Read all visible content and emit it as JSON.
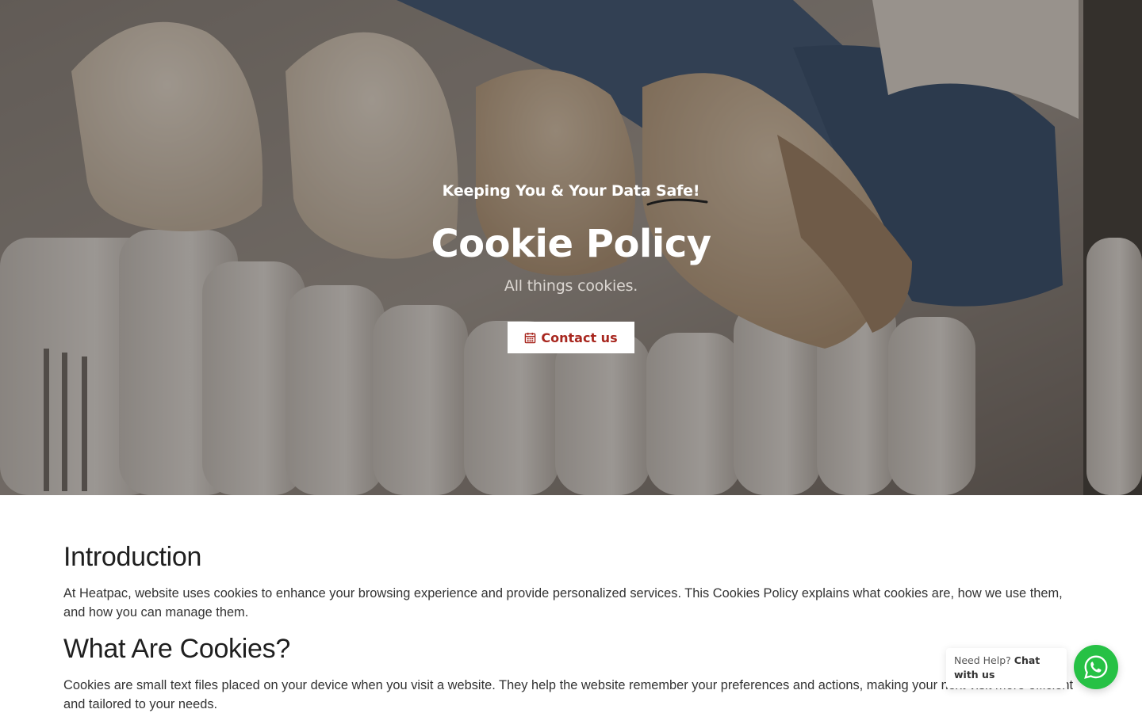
{
  "hero": {
    "tagline_prefix": "Keeping You & Your Data ",
    "tagline_accent": "Safe!",
    "title": "Cookie Policy",
    "subtitle": "All things cookies.",
    "cta_label": "Contact us",
    "cta_icon": "calendar-icon",
    "background_image": "knitted-socks-on-radiator-photo",
    "accent_color": "#a8271f"
  },
  "content": {
    "sections": [
      {
        "heading": "Introduction",
        "body": "At Heatpac, website uses cookies to enhance your browsing experience and provide personalized services. This Cookies Policy explains what cookies are, how we use them, and how you can manage them."
      },
      {
        "heading": "What Are Cookies?",
        "body": "Cookies are small text files placed on your device when you visit a website. They help the website remember your preferences and actions, making your next visit more efficient and tailored to your needs."
      }
    ]
  },
  "chat_widget": {
    "help_prefix": "Need Help?",
    "help_action": "Chat with us",
    "icon": "whatsapp-icon",
    "color": "#26c145"
  }
}
